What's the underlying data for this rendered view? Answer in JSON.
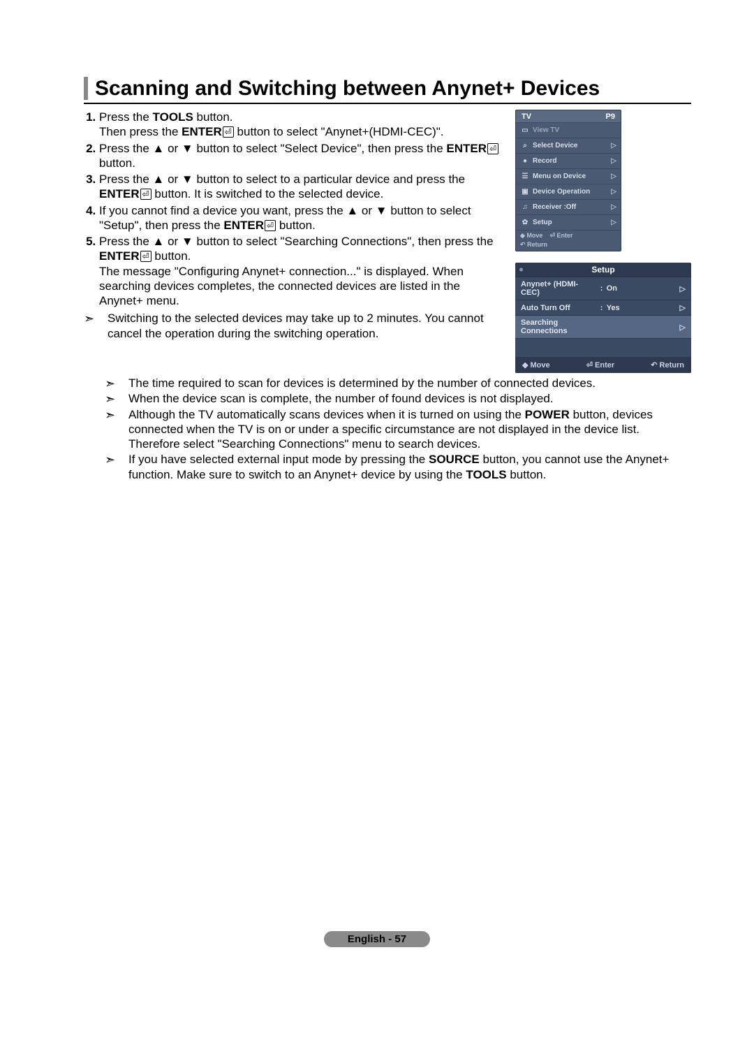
{
  "page_title": "Scanning and Switching between Anynet+ Devices",
  "steps": [
    {
      "pre": "Press the ",
      "b1": "TOOLS",
      "mid1": " button.",
      "br": true,
      "post": "Then press the ",
      "b2": "ENTER",
      "icon": true,
      "tail": " button to select \"Anynet+(HDMI-CEC)\"."
    },
    {
      "text": "Press the ▲ or ▼ button to select \"Select Device\", then press the ",
      "b": "ENTER",
      "icon": true,
      "tail": " button."
    },
    {
      "text": "Press the ▲ or ▼ button to select to a particular device and press the ",
      "b": "ENTER",
      "icon": true,
      "tail": " button. It is switched to the selected device."
    },
    {
      "text": "If you cannot find a device you want, press the ▲ or ▼ button to select \"Setup\", then press the ",
      "b": "ENTER",
      "icon": true,
      "tail": " button."
    },
    {
      "text": "Press the ▲ or ▼ button to select \"Searching Connections\", then press the ",
      "b": "ENTER",
      "icon": true,
      "tail": " button.",
      "extra": "The message \"Configuring Anynet+ connection...\" is displayed. When searching devices completes, the connected devices are listed in the Anynet+ menu."
    }
  ],
  "notes_inline": [
    "Switching to the selected devices may take up to 2 minutes. You cannot cancel the operation during the switching operation."
  ],
  "notes_full": [
    "The time required to scan for devices is determined by the number of connected devices.",
    "When the device scan is complete, the number of found devices is not displayed.",
    {
      "pre": "Although the TV automatically scans devices when it is turned on using the ",
      "b": "POWER",
      "post": " button, devices connected when the TV is on or under a specific circumstance are not displayed in the device list. Therefore select \"Searching Connections\" menu to search devices."
    },
    {
      "pre": "If you have selected external input mode by pressing the ",
      "b": "SOURCE",
      "post": " button, you cannot use the Anynet+ function. Make sure to switch to an Anynet+ device by using the ",
      "b2": "TOOLS",
      "tail": " button."
    }
  ],
  "osd1": {
    "top_left": "TV",
    "top_right": "P9",
    "rows": [
      {
        "label": "View TV",
        "dim": true,
        "arrow": false,
        "icon": "▭"
      },
      {
        "label": "Select Device",
        "arrow": true,
        "icon": "⌕"
      },
      {
        "label": "Record",
        "arrow": true,
        "icon": "●"
      },
      {
        "label": "Menu on Device",
        "arrow": true,
        "icon": "☰"
      },
      {
        "label": "Device Operation",
        "arrow": true,
        "icon": "▣"
      },
      {
        "label": "Receiver   :Off",
        "arrow": true,
        "icon": "♫"
      },
      {
        "label": "Setup",
        "arrow": true,
        "icon": "✿"
      }
    ],
    "hint_move": "◆ Move",
    "hint_enter": "⏎ Enter",
    "hint_return": "↶ Return"
  },
  "osd2": {
    "title": "Setup",
    "rows": [
      {
        "label": "Anynet+ (HDMI-CEC)",
        "sep": ":",
        "value": "On",
        "arrow": true
      },
      {
        "label": "Auto Turn Off",
        "sep": ":",
        "value": "Yes",
        "arrow": true
      },
      {
        "label": "Searching Connections",
        "sep": "",
        "value": "",
        "arrow": true,
        "highlight": true
      }
    ],
    "hint_move": "◆ Move",
    "hint_enter": "⏎ Enter",
    "hint_return": "↶ Return"
  },
  "footer": {
    "lang": "English",
    "page": "57"
  }
}
